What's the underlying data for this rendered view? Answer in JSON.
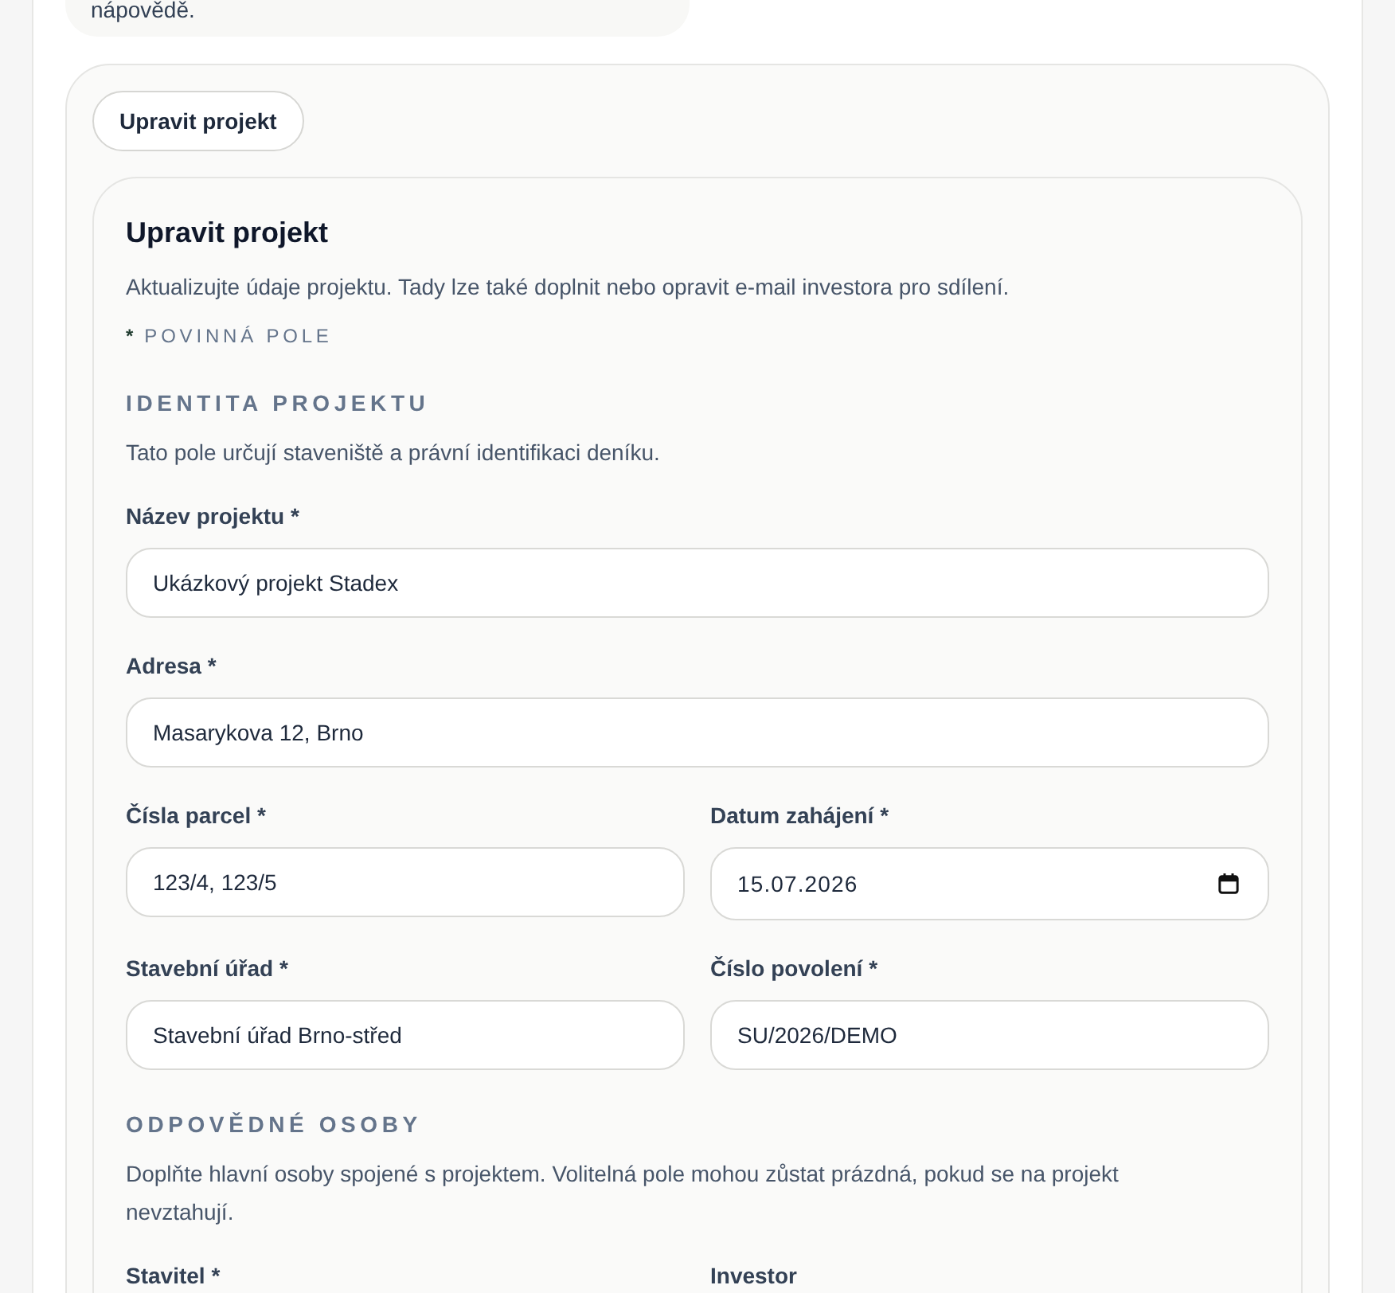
{
  "help_card": {
    "text": "nápovědě."
  },
  "edit_button": {
    "label": "Upravit projekt"
  },
  "form": {
    "title": "Upravit projekt",
    "description": "Aktualizujte údaje projektu. Tady lze také doplnit nebo opravit e-mail investora pro sdílení.",
    "required_note": {
      "marker": "*",
      "text": "POVINNÁ POLE"
    },
    "sections": [
      {
        "heading": "IDENTITA PROJEKTU",
        "description": "Tato pole určují staveniště a právní identifikaci deníku.",
        "rows": [
          [
            {
              "label": "Název projektu *",
              "kind": "text",
              "value": "Ukázkový projekt Stadex"
            }
          ],
          [
            {
              "label": "Adresa *",
              "kind": "text",
              "value": "Masarykova 12, Brno"
            }
          ],
          [
            {
              "label": "Čísla parcel *",
              "kind": "text",
              "value": "123/4, 123/5"
            },
            {
              "label": "Datum zahájení *",
              "kind": "date",
              "value": "15.07.2026"
            }
          ],
          [
            {
              "label": "Stavební úřad *",
              "kind": "text",
              "value": "Stavební úřad Brno-střed"
            },
            {
              "label": "Číslo povolení *",
              "kind": "text",
              "value": "SU/2026/DEMO"
            }
          ]
        ]
      },
      {
        "heading": "ODPOVĚDNÉ OSOBY",
        "description": "Doplňte hlavní osoby spojené s projektem. Volitelná pole mohou zůstat prázdná, pokud se na projekt nevztahují.",
        "rows": [
          [
            {
              "label": "Stavitel *"
            },
            {
              "label": "Investor"
            }
          ]
        ]
      }
    ]
  }
}
